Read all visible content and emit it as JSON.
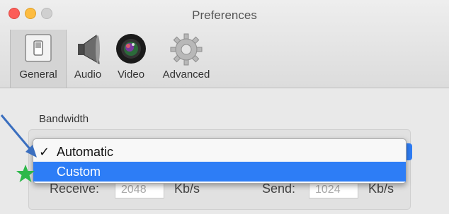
{
  "window": {
    "title": "Preferences"
  },
  "toolbar": {
    "tabs": [
      {
        "label": "General",
        "icon": "switch-icon",
        "selected": true
      },
      {
        "label": "Audio",
        "icon": "speaker-icon",
        "selected": false
      },
      {
        "label": "Video",
        "icon": "camera-lens-icon",
        "selected": false
      },
      {
        "label": "Advanced",
        "icon": "gear-icon",
        "selected": false
      }
    ]
  },
  "bandwidth": {
    "label": "Bandwidth",
    "dropdown": {
      "options": [
        "Automatic",
        "Custom"
      ],
      "checked": "Automatic",
      "highlighted": "Custom"
    },
    "receive": {
      "label": "Receive:",
      "value": "2048",
      "unit": "Kb/s"
    },
    "send": {
      "label": "Send:",
      "value": "1024",
      "unit": "Kb/s"
    }
  },
  "colors": {
    "highlight": "#2d7df6",
    "annotation_arrow": "#3b6fbf",
    "annotation_star": "#2db84a"
  }
}
